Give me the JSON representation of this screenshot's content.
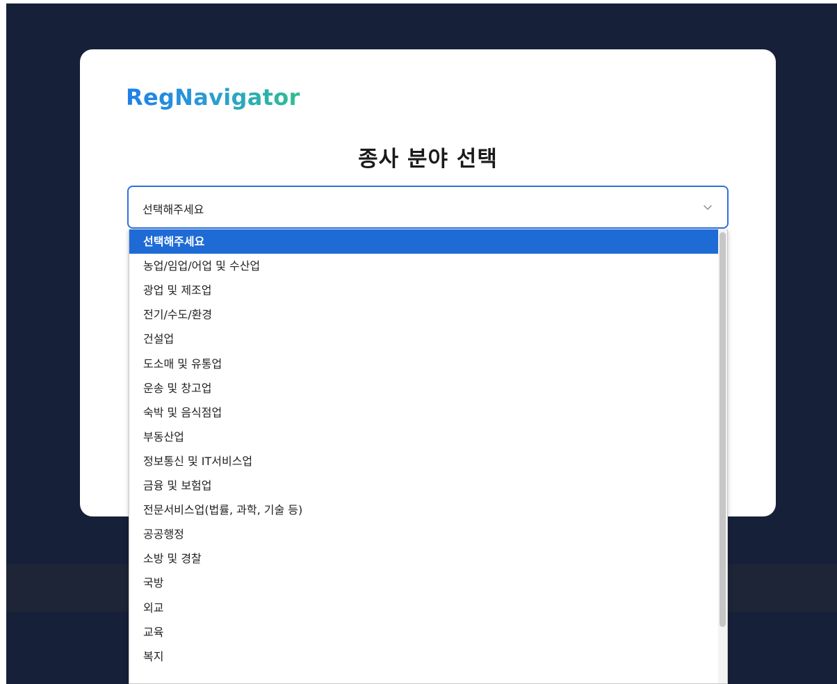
{
  "app": {
    "logo_text": "RegNavigator"
  },
  "card": {
    "title": "종사 분야 선택"
  },
  "select": {
    "current_value": "선택해주세요",
    "icon": "chevron-down-icon",
    "accent_color": "#2f6fdc"
  },
  "dropdown": {
    "selected_index": 0,
    "options": [
      "선택해주세요",
      "농업/임업/어업 및 수산업",
      "광업 및 제조업",
      "전기/수도/환경",
      "건설업",
      "도소매 및 유통업",
      "운송 및 창고업",
      "숙박 및 음식점업",
      "부동산업",
      "정보통신 및 IT서비스업",
      "금융 및 보험업",
      "전문서비스업(법률, 과학, 기술 등)",
      "공공행정",
      "소방 및 경찰",
      "국방",
      "외교",
      "교육",
      "복지"
    ],
    "highlight_color": "#1e6bd6"
  },
  "colors": {
    "background": "#172039",
    "logo_gradient_start": "#1f7fe8",
    "logo_gradient_end": "#2fbf8f"
  }
}
